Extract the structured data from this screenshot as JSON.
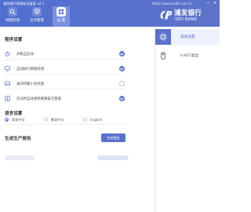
{
  "window": {
    "title": "浦发银行网银安全管家 v2.1",
    "url": "https://www.spdb.com.cn",
    "controls": [
      "—",
      "×"
    ]
  },
  "tabs": [
    {
      "label": "网银检测",
      "icon": "search-icon"
    },
    {
      "label": "证书管理",
      "icon": "certificate-icon"
    },
    {
      "label": "设 置",
      "icon": "settings-icon",
      "active": true
    }
  ],
  "brand": {
    "name_cn": "浦发银行",
    "name_en": "SPD BANK"
  },
  "sidebar": {
    "items": [
      {
        "label": "基础设置",
        "icon": "settings-icon",
        "active": true
      },
      {
        "label": "U-KEY类型",
        "icon": "usb-key-icon",
        "active": false
      }
    ]
  },
  "program_settings": {
    "title": "程序设置",
    "options": [
      {
        "label": "开机自启动",
        "icon": "power-icon",
        "checked": true
      },
      {
        "label": "自动执行网银检测",
        "icon": "monitor-icon",
        "checked": true
      },
      {
        "label": "关闭时最小化托盘",
        "icon": "tray-icon",
        "checked": false
      },
      {
        "label": "启动时自动更新网银安全管家",
        "icon": "update-icon",
        "checked": true
      }
    ]
  },
  "language": {
    "title": "语言设置",
    "options": [
      {
        "label": "简体中文",
        "selected": true
      },
      {
        "label": "繁体中文",
        "selected": false
      },
      {
        "label": "English",
        "selected": false
      }
    ]
  },
  "report": {
    "title": "生成生产报告",
    "button": "生成报告"
  },
  "colors": {
    "accent": "#5a72cd",
    "header": "#5a72cd",
    "active_bg": "#edf1fb"
  }
}
